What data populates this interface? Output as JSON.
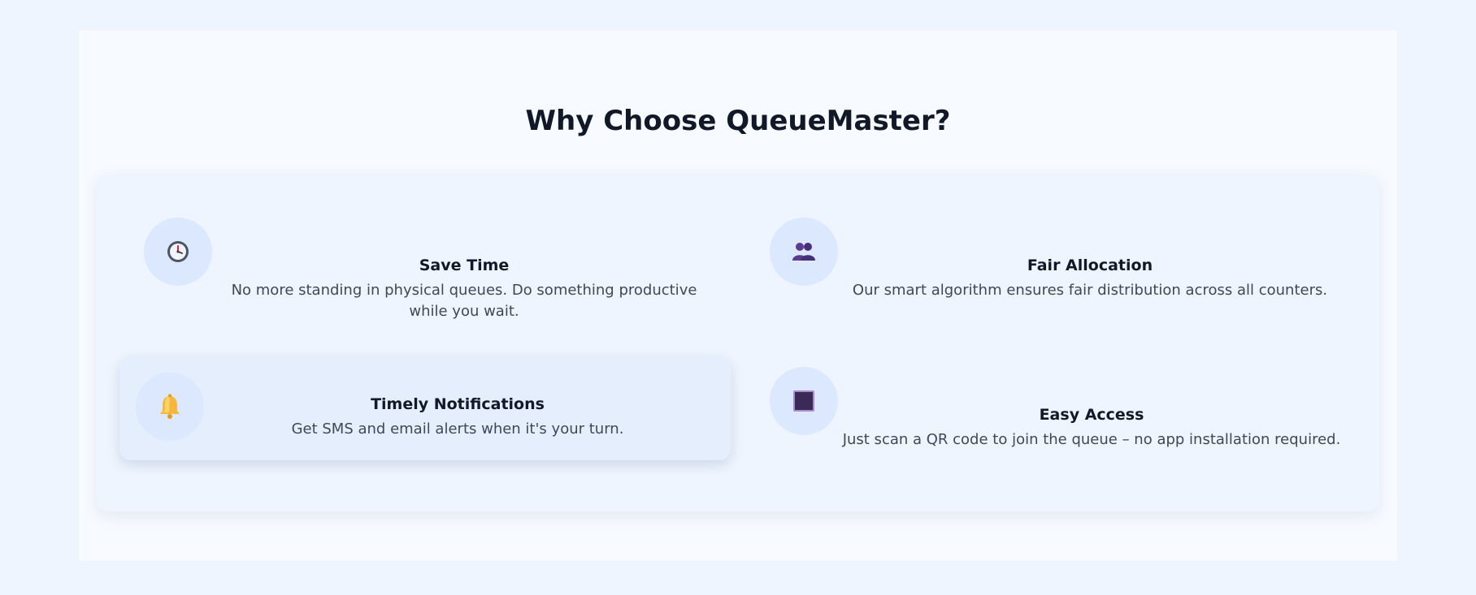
{
  "section": {
    "heading": "Why Choose QueueMaster?"
  },
  "features": [
    {
      "title": "Save Time",
      "description": "No more standing in physical queues. Do something productive while you wait.",
      "icon": "clock-icon"
    },
    {
      "title": "Fair Allocation",
      "description": "Our smart algorithm ensures fair distribution across all counters.",
      "icon": "people-icon"
    },
    {
      "title": "Timely Notifications",
      "description": "Get SMS and email alerts when it's your turn.",
      "icon": "bell-icon"
    },
    {
      "title": "Easy Access",
      "description": "Just scan a QR code to join the queue – no app installation required.",
      "icon": "qr-code-icon"
    }
  ],
  "colors": {
    "page_background": "#eef5fe",
    "section_background": "#f7fafe",
    "icon_circle": "#dbe8fd",
    "heading": "#111827",
    "body_text": "#3f4856"
  }
}
